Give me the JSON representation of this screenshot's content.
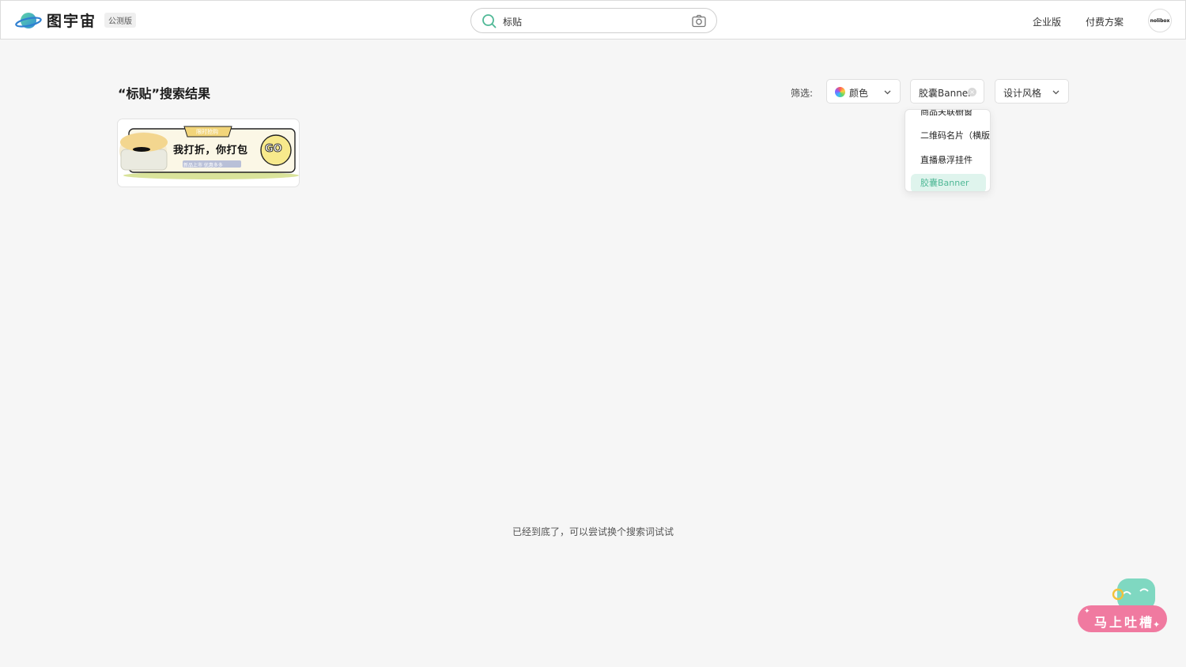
{
  "header": {
    "brand": "图宇宙",
    "badge": "公测版",
    "search_value": "标贴",
    "nav": [
      "企业版",
      "付费方案"
    ],
    "avatar_text": "nolibox"
  },
  "results": {
    "title": "“标贴”搜索结果",
    "filter_label": "筛选:",
    "filters": {
      "color": "颜色",
      "category": "胶囊Banner",
      "style": "设计风格"
    }
  },
  "dropdown": {
    "items": [
      "商品关联橱窗",
      "二维码名片（横版）",
      "直播悬浮挂件",
      "胶囊Banner"
    ],
    "selected_index": 3
  },
  "cards": [
    {
      "headline": "我打折，你打包",
      "tag": "限时抢购",
      "subline": "新品上市 优惠多多",
      "cta": "GO"
    }
  ],
  "footer": {
    "end_text": "已经到底了，可以尝试换个搜索词试试"
  },
  "feedback": {
    "label": "马上吐槽"
  },
  "colors": {
    "accent": "#4fb896",
    "selected_bg": "#dff4ed",
    "feedback_pink": "#f06d95"
  }
}
